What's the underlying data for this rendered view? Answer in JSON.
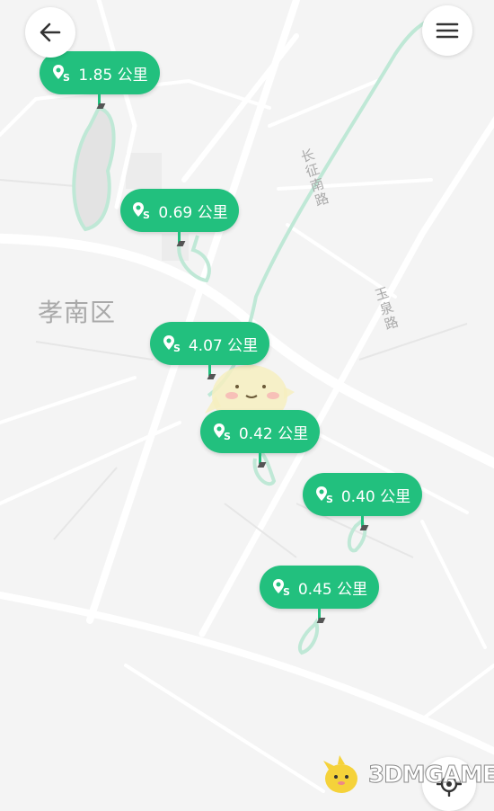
{
  "map": {
    "district_label": "孝南区",
    "road_labels": [
      {
        "name": "长征南路"
      },
      {
        "name": "玉泉路"
      }
    ],
    "route_color": "#bfe8d6",
    "pin_color": "#22c07e"
  },
  "nav": {
    "back_icon": "back-arrow-icon",
    "menu_icon": "menu-icon",
    "locate_icon": "locate-icon"
  },
  "routes": [
    {
      "distance": "1.85 公里"
    },
    {
      "distance": "0.69 公里"
    },
    {
      "distance": "4.07 公里"
    },
    {
      "distance": "0.42 公里"
    },
    {
      "distance": "0.40 公里"
    },
    {
      "distance": "0.45 公里"
    }
  ],
  "watermark": {
    "text": "3DMGAME"
  }
}
